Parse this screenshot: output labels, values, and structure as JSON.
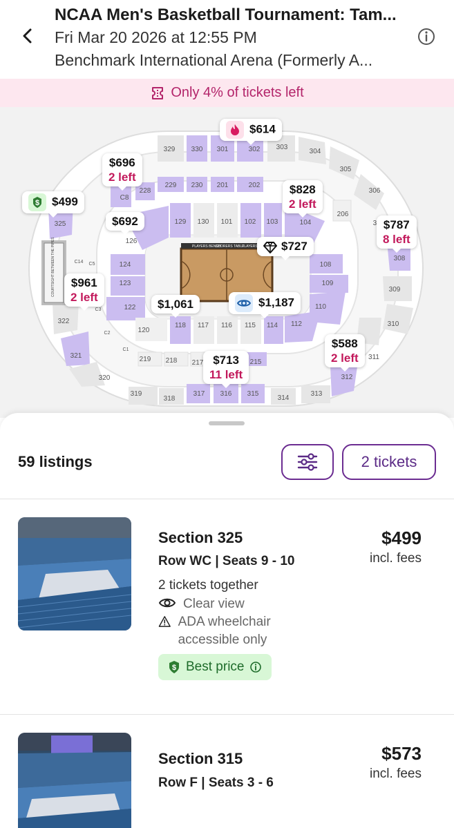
{
  "header": {
    "title": "NCAA Men's Basketball Tournament: Tam...",
    "date": "Fri Mar 20 2026 at 12:55 PM",
    "venue": "Benchmark International Arena (Formerly A..."
  },
  "alert": {
    "text": "Only 4% of tickets left",
    "icon": "ticket-icon",
    "color": "#b3246a"
  },
  "map": {
    "court_labels": {
      "bench": "PLAYERS BENCH",
      "scorers": "SCORERS TABLE",
      "bench2": "PLAYERS BENCH"
    },
    "side_sign": "COURTSIGHT BETWEEN THE PIPES",
    "sections": [
      "329",
      "330",
      "301",
      "302",
      "303",
      "304",
      "305",
      "306",
      "229",
      "230",
      "201",
      "202",
      "C8",
      "228",
      "325",
      "129",
      "130",
      "101",
      "102",
      "103",
      "104",
      "206",
      "307",
      "126",
      "308",
      "124",
      "108",
      "123",
      "109",
      "122",
      "110",
      "118",
      "117",
      "116",
      "115",
      "114",
      "112",
      "120",
      "309",
      "310",
      "322",
      "321",
      "219",
      "218",
      "217",
      "215",
      "311",
      "320",
      "319",
      "318",
      "317",
      "316",
      "315",
      "314",
      "313",
      "312",
      "C5",
      "C14",
      "C2",
      "C1",
      "C3"
    ],
    "pins": [
      {
        "price": "$614",
        "icon": "fire-icon"
      },
      {
        "price": "$696",
        "left": "2 left"
      },
      {
        "price": "$499",
        "icon": "dollar-badge-icon"
      },
      {
        "price": "$692"
      },
      {
        "price": "$828",
        "left": "2 left"
      },
      {
        "price": "$787",
        "left": "8 left"
      },
      {
        "price": "$727",
        "icon": "diamond-icon"
      },
      {
        "price": "$961",
        "left": "2 left"
      },
      {
        "price": "$1,061"
      },
      {
        "price": "$1,187",
        "icon": "eye-icon"
      },
      {
        "price": "$588",
        "left": "2 left"
      },
      {
        "price": "$713",
        "left": "11 left"
      }
    ]
  },
  "sheet": {
    "count": "59 listings",
    "tickets_label": "2 tickets"
  },
  "listings": [
    {
      "section": "Section 325",
      "row": "Row WC | Seats 9 - 10",
      "price": "$499",
      "fees": "incl. fees",
      "together": "2 tickets together",
      "features": [
        "Clear view",
        "ADA wheelchair accessible only"
      ],
      "badge": "Best price"
    },
    {
      "section": "Section 315",
      "row": "Row F | Seats 3 - 6",
      "price": "$573",
      "fees": "incl. fees"
    }
  ],
  "colors": {
    "accent": "#6b2c91",
    "available": "#cbbdf0",
    "unavailable": "#e6e6e6",
    "badge_bg": "#d8f7d6"
  }
}
